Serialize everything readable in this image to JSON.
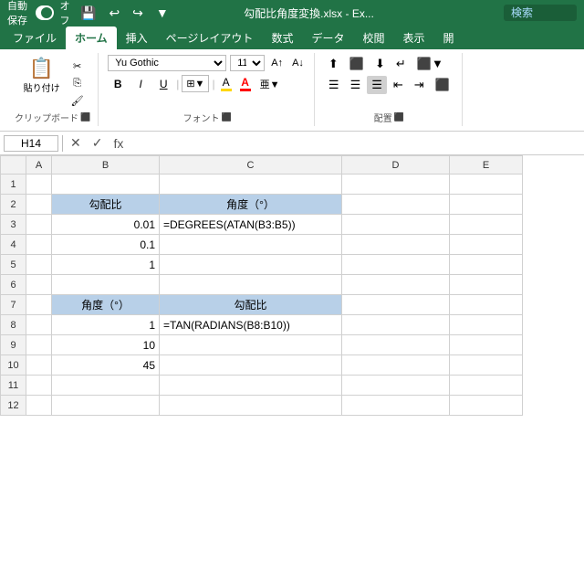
{
  "titlebar": {
    "autosave_label": "自動保存",
    "toggle_state": "オフ",
    "filename": "勾配比角度変換.xlsx  -  Ex...",
    "search_placeholder": "検索"
  },
  "ribbon_tabs": [
    {
      "label": "ファイル",
      "active": false
    },
    {
      "label": "ホーム",
      "active": true
    },
    {
      "label": "挿入",
      "active": false
    },
    {
      "label": "ページレイアウト",
      "active": false
    },
    {
      "label": "数式",
      "active": false
    },
    {
      "label": "データ",
      "active": false
    },
    {
      "label": "校閲",
      "active": false
    },
    {
      "label": "表示",
      "active": false
    },
    {
      "label": "開",
      "active": false
    }
  ],
  "clipboard": {
    "paste_label": "貼り付け",
    "group_label": "クリップボード"
  },
  "font": {
    "name": "Yu Gothic",
    "size": "11",
    "group_label": "フォント"
  },
  "alignment": {
    "group_label": "配置"
  },
  "formula_bar": {
    "cell_ref": "H14",
    "formula": ""
  },
  "columns": [
    "",
    "A",
    "B",
    "C",
    "D",
    "E"
  ],
  "rows": [
    {
      "row": "1",
      "cells": [
        "",
        "",
        "",
        "",
        ""
      ]
    },
    {
      "row": "2",
      "cells": [
        "",
        "勾配比",
        "角度（°）",
        "",
        ""
      ]
    },
    {
      "row": "3",
      "cells": [
        "",
        "0.01",
        "=DEGREES(ATAN(B3:B5))",
        "",
        ""
      ]
    },
    {
      "row": "4",
      "cells": [
        "",
        "0.1",
        "",
        "",
        ""
      ]
    },
    {
      "row": "5",
      "cells": [
        "",
        "1",
        "",
        "",
        ""
      ]
    },
    {
      "row": "6",
      "cells": [
        "",
        "",
        "",
        "",
        ""
      ]
    },
    {
      "row": "7",
      "cells": [
        "",
        "角度（°）",
        "勾配比",
        "",
        ""
      ]
    },
    {
      "row": "8",
      "cells": [
        "",
        "1",
        "=TAN(RADIANS(B8:B10))",
        "",
        ""
      ]
    },
    {
      "row": "9",
      "cells": [
        "",
        "10",
        "",
        "",
        ""
      ]
    },
    {
      "row": "10",
      "cells": [
        "",
        "45",
        "",
        "",
        ""
      ]
    },
    {
      "row": "11",
      "cells": [
        "",
        "",
        "",
        "",
        ""
      ]
    },
    {
      "row": "12",
      "cells": [
        "",
        "",
        "",
        "",
        ""
      ]
    }
  ]
}
